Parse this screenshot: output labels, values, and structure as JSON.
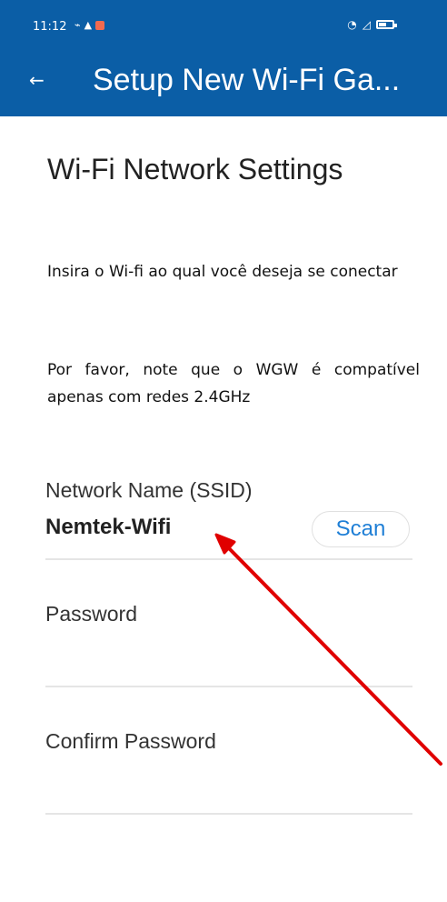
{
  "status_bar": {
    "time": "11:12",
    "left_icons": [
      "signal-icon",
      "notification-icon",
      "app-icon"
    ],
    "right_icons": [
      "wifi-icon",
      "cell-signal-icon",
      "battery-icon"
    ]
  },
  "app_bar": {
    "back_icon": "←",
    "title": "Setup New Wi-Fi Ga..."
  },
  "main": {
    "section_title": "Wi-Fi Network Settings",
    "info_text_1": "Insira o Wi-fi ao qual você deseja se conectar",
    "info_text_2": "Por favor, note que o WGW é compatível apenas com redes 2.4GHz",
    "fields": [
      {
        "label": "Network Name (SSID)",
        "value": "Nemtek-Wifi"
      },
      {
        "label": "Password",
        "value": ""
      },
      {
        "label": "Confirm Password",
        "value": ""
      }
    ],
    "scan_label": "Scan"
  },
  "colors": {
    "primary": "#0b5ea6",
    "accent": "#1f7fd6",
    "annotation_arrow": "#e00000"
  }
}
